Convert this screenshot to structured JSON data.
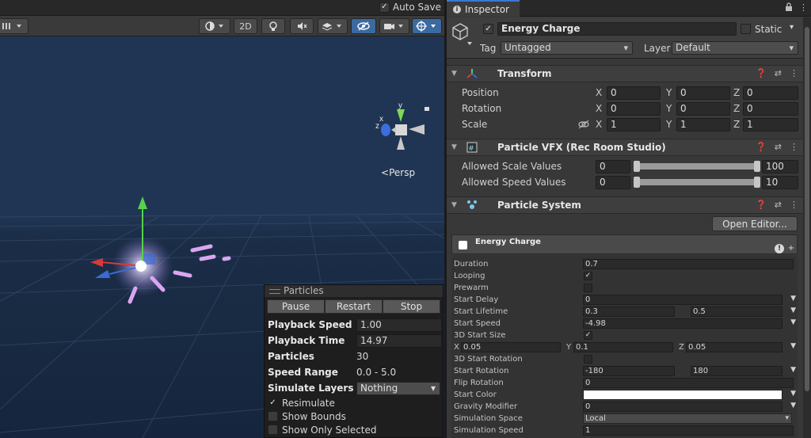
{
  "scene": {
    "autosave_label": "Auto Save",
    "autosave_checked": true,
    "toolbar": {
      "twod_label": "2D"
    },
    "persp_label": "Persp",
    "gizmo": {
      "y": "y",
      "x": "x",
      "z": "z"
    }
  },
  "particles_panel": {
    "title": "Particles",
    "pause": "Pause",
    "restart": "Restart",
    "stop": "Stop",
    "playback_speed_label": "Playback Speed",
    "playback_speed": "1.00",
    "playback_time_label": "Playback Time",
    "playback_time": "14.97",
    "particles_label": "Particles",
    "particles": "30",
    "speed_range_label": "Speed Range",
    "speed_range": "0.0 - 5.0",
    "simulate_layers_label": "Simulate Layers",
    "simulate_layers": "Nothing",
    "resimulate": "Resimulate",
    "show_bounds": "Show Bounds",
    "show_only_selected": "Show Only Selected"
  },
  "inspector": {
    "tab_label": "Inspector",
    "object_name": "Energy Charge",
    "static_label": "Static",
    "tag_label": "Tag",
    "tag_value": "Untagged",
    "layer_label": "Layer",
    "layer_value": "Default",
    "transform": {
      "title": "Transform",
      "position_label": "Position",
      "rotation_label": "Rotation",
      "scale_label": "Scale",
      "axis_x": "X",
      "axis_y": "Y",
      "axis_z": "Z",
      "position": [
        "0",
        "0",
        "0"
      ],
      "rotation": [
        "0",
        "0",
        "0"
      ],
      "scale": [
        "1",
        "1",
        "1"
      ]
    },
    "vfx": {
      "title": "Particle VFX (Rec Room Studio)",
      "allowed_scale_label": "Allowed Scale Values",
      "allowed_scale_min": "0",
      "allowed_scale_max": "100",
      "allowed_speed_label": "Allowed Speed Values",
      "allowed_speed_min": "0",
      "allowed_speed_max": "10"
    },
    "particle_system": {
      "title": "Particle System",
      "open_editor": "Open Editor...",
      "system_name": "Energy Charge",
      "rows": {
        "duration_label": "Duration",
        "duration": "0.7",
        "looping_label": "Looping",
        "prewarm_label": "Prewarm",
        "start_delay_label": "Start Delay",
        "start_delay": "0",
        "start_lifetime_label": "Start Lifetime",
        "start_lifetime_a": "0.3",
        "start_lifetime_b": "0.5",
        "start_speed_label": "Start Speed",
        "start_speed": "-4.98",
        "start_size_3d_label": "3D Start Size",
        "size_x": "0.05",
        "size_y": "0.1",
        "size_z": "0.05",
        "start_rotation_3d_label": "3D Start Rotation",
        "start_rotation_label": "Start Rotation",
        "start_rotation_a": "-180",
        "start_rotation_b": "180",
        "flip_rotation_label": "Flip Rotation",
        "flip_rotation": "0",
        "start_color_label": "Start Color",
        "gravity_label": "Gravity Modifier",
        "gravity": "0",
        "sim_space_label": "Simulation Space",
        "sim_space": "Local",
        "sim_speed_label": "Simulation Speed",
        "sim_speed": "1"
      }
    }
  }
}
